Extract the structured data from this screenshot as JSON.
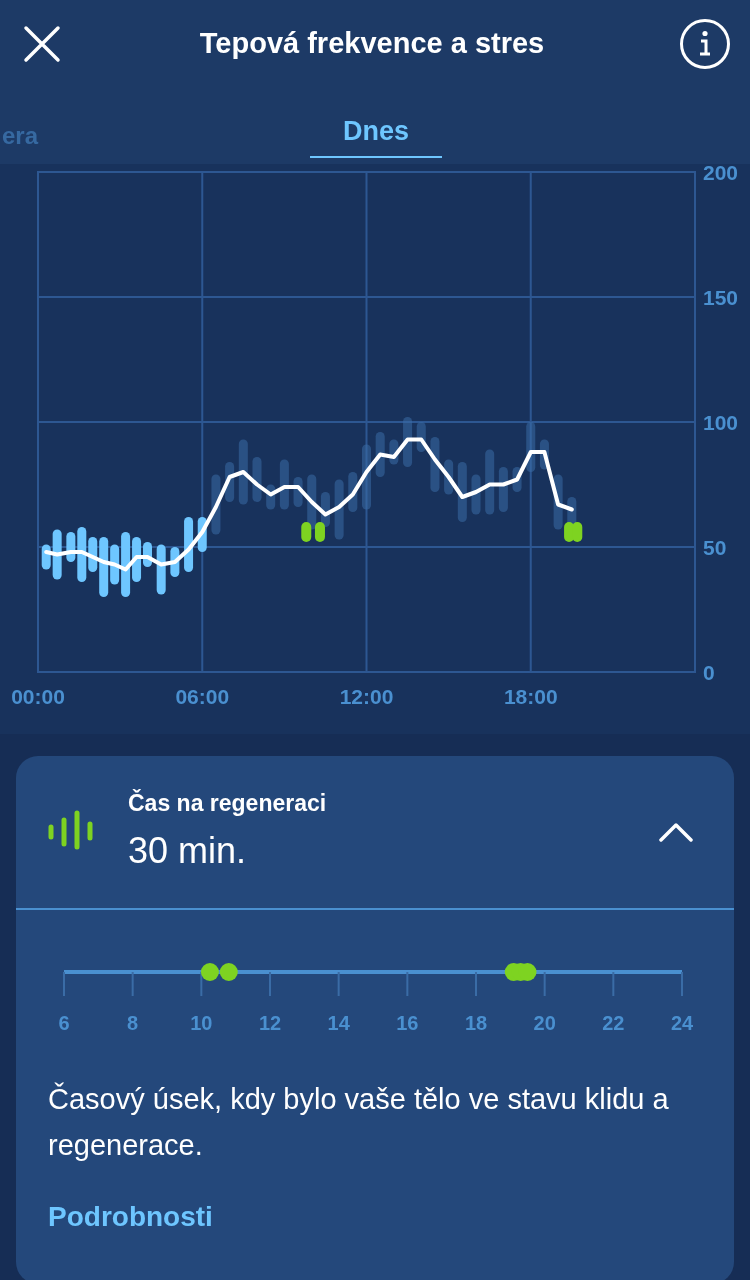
{
  "header": {
    "title": "Tepová frekvence a stres"
  },
  "tabs": [
    {
      "label": "era",
      "selected": false
    },
    {
      "label": "Dnes",
      "selected": true
    }
  ],
  "heart_rate_chart": {
    "chart_data": {
      "type": "line",
      "x": [
        0.3,
        0.7,
        1.2,
        1.6,
        2,
        2.4,
        2.8,
        3.2,
        3.6,
        4,
        4.5,
        5,
        5.5,
        6,
        6.5,
        7,
        7.5,
        8,
        8.5,
        9,
        9.5,
        10,
        10.5,
        11,
        11.5,
        12,
        12.5,
        13,
        13.5,
        14,
        14.5,
        15,
        15.5,
        16,
        16.5,
        17,
        17.5,
        18,
        18.5,
        19,
        19.5
      ],
      "grid": true,
      "series": [
        {
          "color": "#ffffff",
          "values": [
            48,
            47,
            48,
            48,
            46,
            44,
            43,
            41,
            46,
            46,
            43,
            44,
            49,
            56,
            66,
            78,
            80,
            75,
            71,
            74,
            74,
            68,
            63,
            66,
            71,
            80,
            87,
            86,
            93,
            93,
            85,
            78,
            70,
            72,
            75,
            75,
            77,
            88,
            88,
            67,
            65
          ]
        }
      ],
      "xlim": [
        0,
        24
      ],
      "ylim": [
        0,
        200
      ],
      "xticks": [
        {
          "value": 0,
          "label": "00:00"
        },
        {
          "value": 6,
          "label": "06:00"
        },
        {
          "value": 12,
          "label": "12:00"
        },
        {
          "value": 18,
          "label": "18:00"
        }
      ],
      "yticks": [
        0,
        50,
        100,
        150,
        200
      ]
    }
  },
  "regeneration": {
    "title": "Čas na regeneraci",
    "value": "30 min.",
    "expanded": true,
    "timeline_labels": [
      "6",
      "8",
      "10",
      "12",
      "14",
      "16",
      "18",
      "20",
      "22",
      "24"
    ],
    "description": "Časový úsek, kdy bylo vaše tělo ve stavu klidu a regenerace.",
    "link": "Podrobnosti"
  }
}
